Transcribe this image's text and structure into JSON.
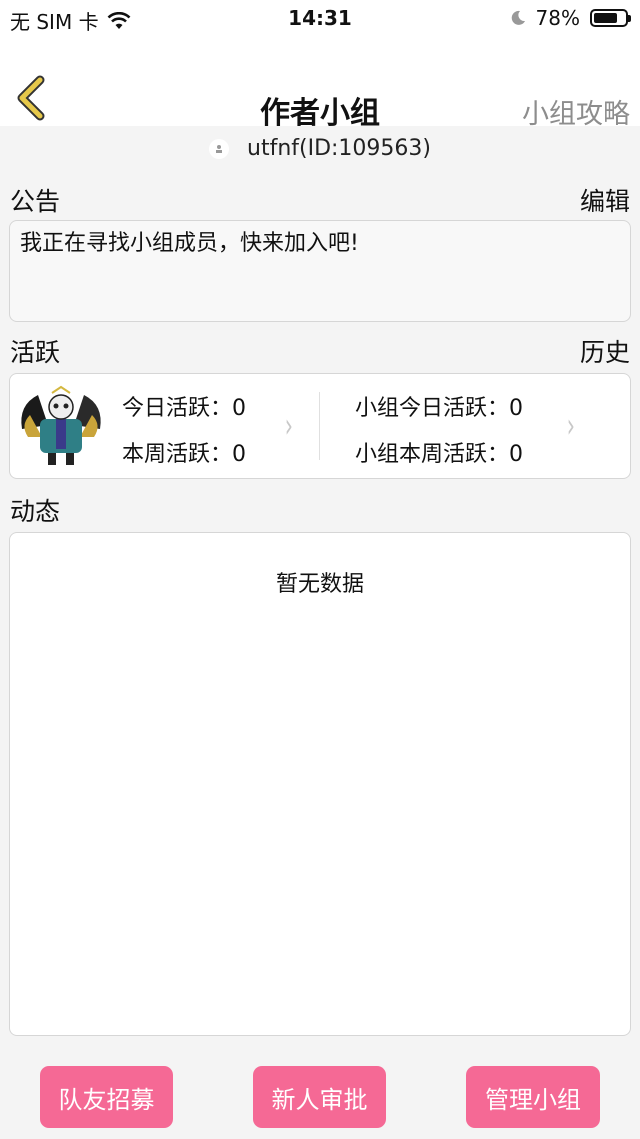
{
  "status_bar": {
    "carrier": "无 SIM 卡",
    "time": "14:31",
    "battery_text": "78%",
    "battery_level": 0.78,
    "wifi_icon": "wifi-icon",
    "moon_icon": "moon-icon"
  },
  "nav": {
    "back_icon": "chevron-left-icon",
    "title": "作者小组",
    "right_link": "小组攻略"
  },
  "user": {
    "label": "utfnf(ID:109563)"
  },
  "announcement": {
    "label": "公告",
    "edit": "编辑",
    "text": "我正在寻找小组成员，快来加入吧!"
  },
  "activity": {
    "label": "活跃",
    "history": "历史",
    "today_label": "今日活跃：",
    "today_value": "0",
    "week_label": "本周活跃：",
    "week_value": "0",
    "group_today_label": "小组今日活跃：",
    "group_today_value": "0",
    "group_week_label": "小组本周活跃：",
    "group_week_value": "0",
    "chevron": "›"
  },
  "feed": {
    "label": "动态",
    "empty": "暂无数据"
  },
  "buttons": {
    "recruit": "队友招募",
    "approve": "新人审批",
    "manage": "管理小组"
  },
  "colors": {
    "accent": "#f56995",
    "back_icon": "#e6c84a",
    "muted": "#8d8d8d"
  }
}
